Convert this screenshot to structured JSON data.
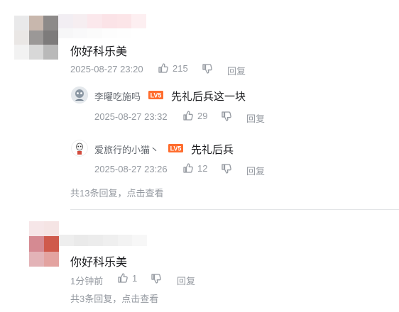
{
  "comments": [
    {
      "text": "你好科乐美",
      "time": "2025-08-27 23:20",
      "likes": "215",
      "reply_label": "回复",
      "replies": [
        {
          "user": "李曜吃施吗",
          "text": "先礼后兵这一块",
          "time": "2025-08-27 23:32",
          "likes": "29",
          "reply_label": "回复"
        },
        {
          "user": "爱旅行的小猫丶",
          "text": "先礼后兵",
          "time": "2025-08-27 23:26",
          "likes": "12",
          "reply_label": "回复"
        }
      ],
      "more_replies": "共13条回复，点击查看"
    },
    {
      "text": "你好科乐美",
      "time": "1分钟前",
      "likes": "1",
      "reply_label": "回复",
      "replies": [],
      "more_replies": "共3条回复，点击查看"
    }
  ],
  "colors": {
    "text": "#18191c",
    "meta": "#9499a0",
    "username": "#61666d",
    "level_badge": "#ff6d2e",
    "divider": "#e3e5e7"
  },
  "icons": [
    "thumb-up-icon",
    "thumb-down-icon"
  ]
}
